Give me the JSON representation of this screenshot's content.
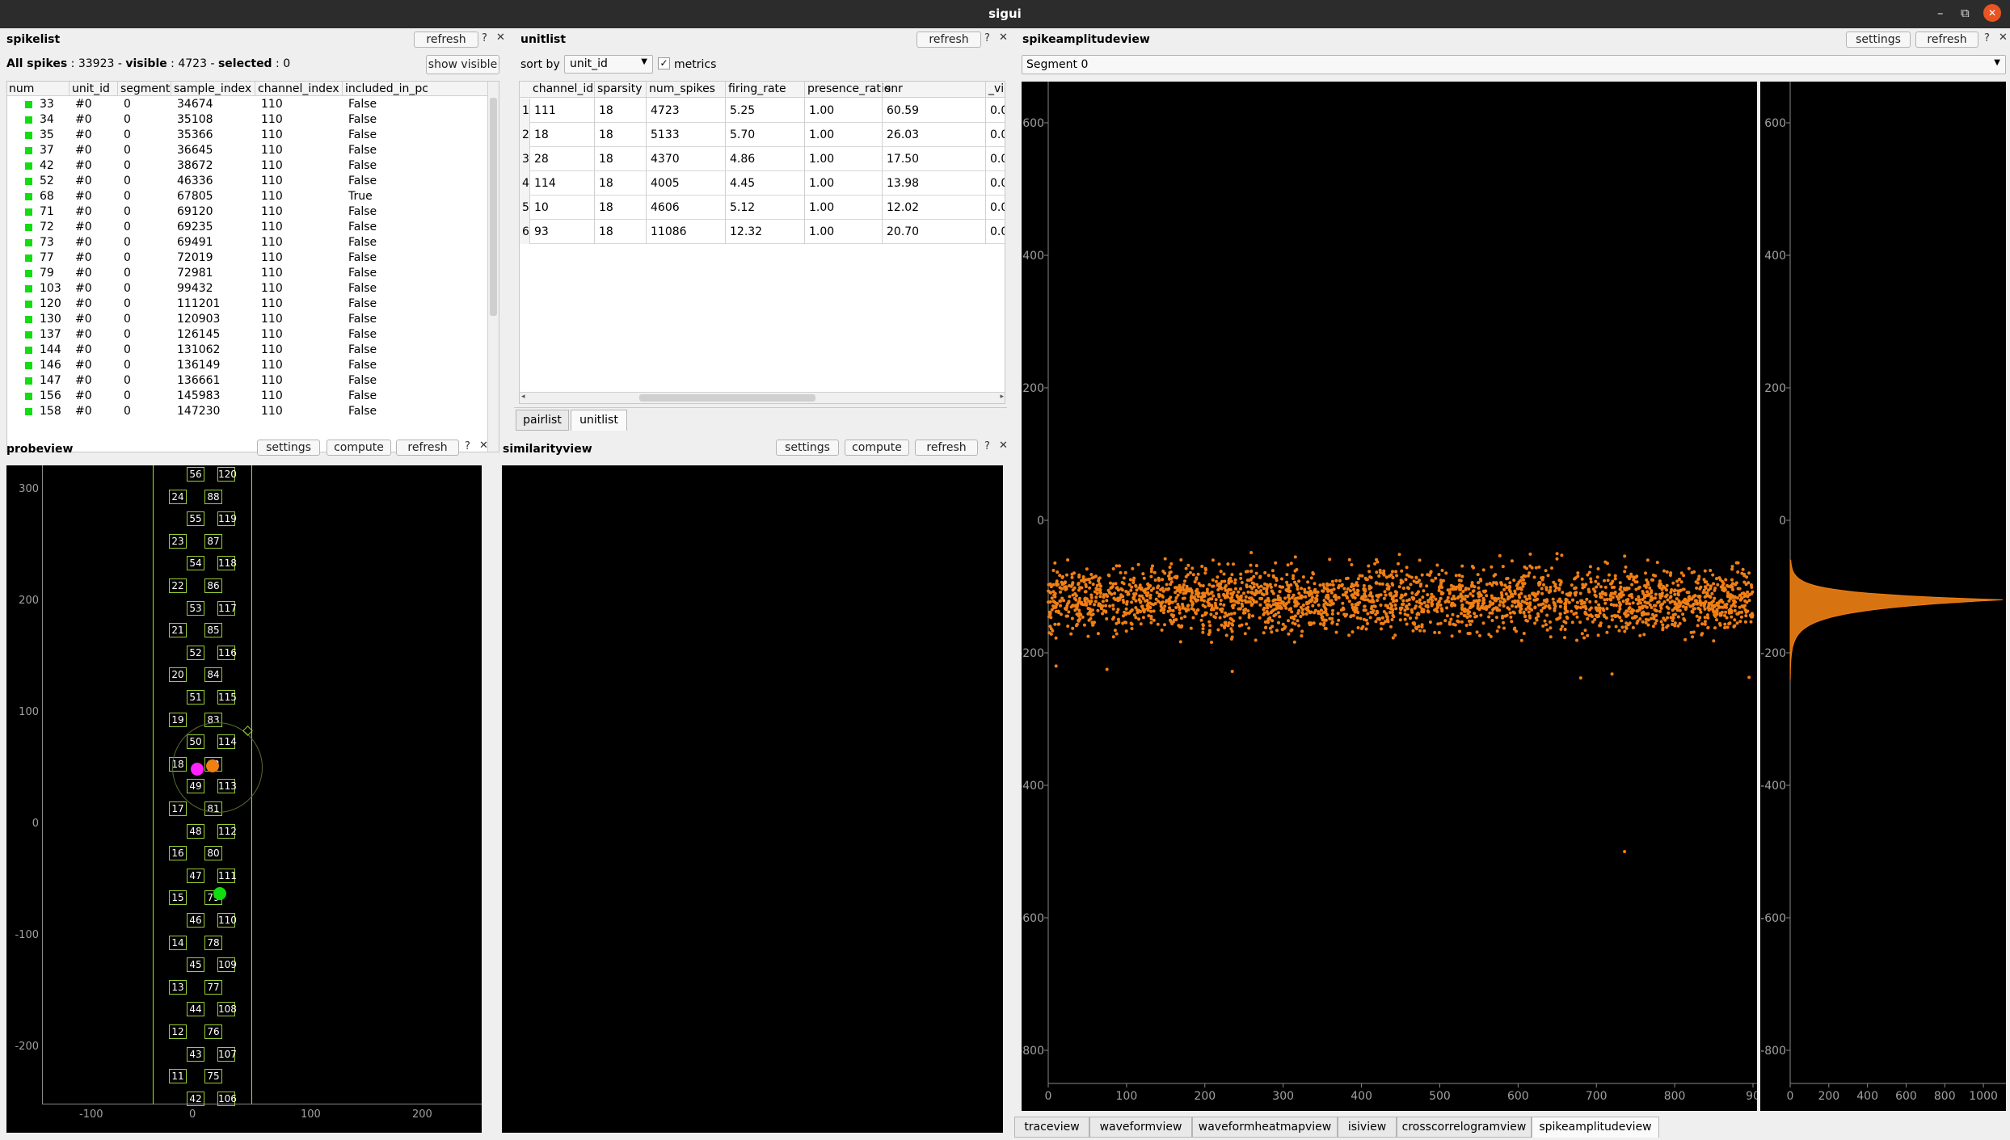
{
  "window": {
    "title": "sigui"
  },
  "colors": {
    "accent_orange": "#f07f14",
    "green": "#11dd11",
    "magenta": "#ff22ff",
    "probe_outline": "#9acd32"
  },
  "spikelist": {
    "title": "spikelist",
    "refresh_label": "refresh",
    "help_label": "?",
    "close_label": "✕",
    "summary_all_label": "All spikes",
    "summary_all": "33923",
    "summary_visible_label": "visible",
    "summary_visible": "4723",
    "summary_selected_label": "selected",
    "summary_selected": "0",
    "show_visible_label": "show visible",
    "columns": [
      "num",
      "unit_id",
      "segment",
      "sample_index",
      "channel_index",
      "included_in_pc"
    ],
    "rows": [
      [
        "33",
        "#0",
        "0",
        "34674",
        "110",
        "False"
      ],
      [
        "34",
        "#0",
        "0",
        "35108",
        "110",
        "False"
      ],
      [
        "35",
        "#0",
        "0",
        "35366",
        "110",
        "False"
      ],
      [
        "37",
        "#0",
        "0",
        "36645",
        "110",
        "False"
      ],
      [
        "42",
        "#0",
        "0",
        "38672",
        "110",
        "False"
      ],
      [
        "52",
        "#0",
        "0",
        "46336",
        "110",
        "False"
      ],
      [
        "68",
        "#0",
        "0",
        "67805",
        "110",
        "True"
      ],
      [
        "71",
        "#0",
        "0",
        "69120",
        "110",
        "False"
      ],
      [
        "72",
        "#0",
        "0",
        "69235",
        "110",
        "False"
      ],
      [
        "73",
        "#0",
        "0",
        "69491",
        "110",
        "False"
      ],
      [
        "77",
        "#0",
        "0",
        "72019",
        "110",
        "False"
      ],
      [
        "79",
        "#0",
        "0",
        "72981",
        "110",
        "False"
      ],
      [
        "103",
        "#0",
        "0",
        "99432",
        "110",
        "False"
      ],
      [
        "120",
        "#0",
        "0",
        "111201",
        "110",
        "False"
      ],
      [
        "130",
        "#0",
        "0",
        "120903",
        "110",
        "False"
      ],
      [
        "137",
        "#0",
        "0",
        "126145",
        "110",
        "False"
      ],
      [
        "144",
        "#0",
        "0",
        "131062",
        "110",
        "False"
      ],
      [
        "146",
        "#0",
        "0",
        "136149",
        "110",
        "False"
      ],
      [
        "147",
        "#0",
        "0",
        "136661",
        "110",
        "False"
      ],
      [
        "156",
        "#0",
        "0",
        "145983",
        "110",
        "False"
      ],
      [
        "158",
        "#0",
        "0",
        "147230",
        "110",
        "False"
      ]
    ]
  },
  "unitlist": {
    "title": "unitlist",
    "refresh_label": "refresh",
    "help_label": "?",
    "close_label": "✕",
    "sort_by_label": "sort by",
    "sort_value": "unit_id",
    "metrics_label": "metrics",
    "metrics_checked": "✓",
    "columns": [
      "channel_id",
      "sparsity",
      "num_spikes",
      "firing_rate",
      "presence_ratio",
      "snr",
      "_viola"
    ],
    "rows": [
      [
        "1",
        "111",
        "18",
        "4723",
        "5.25",
        "1.00",
        "60.59",
        "0.00"
      ],
      [
        "2",
        "18",
        "18",
        "5133",
        "5.70",
        "1.00",
        "26.03",
        "0.00"
      ],
      [
        "3",
        "28",
        "18",
        "4370",
        "4.86",
        "1.00",
        "17.50",
        "0.00"
      ],
      [
        "4",
        "114",
        "18",
        "4005",
        "4.45",
        "1.00",
        "13.98",
        "0.00"
      ],
      [
        "5",
        "10",
        "18",
        "4606",
        "5.12",
        "1.00",
        "12.02",
        "0.00"
      ],
      [
        "6",
        "93",
        "18",
        "11086",
        "12.32",
        "1.00",
        "20.70",
        "0.00"
      ]
    ],
    "tabs": [
      "pairlist",
      "unitlist"
    ]
  },
  "probeview": {
    "title": "probeview",
    "settings_label": "settings",
    "compute_label": "compute",
    "refresh_label": "refresh",
    "help_label": "?",
    "close_label": "✕",
    "y_ticks": [
      "300",
      "200",
      "100",
      "0",
      "-100",
      "-200"
    ],
    "x_ticks": [
      "-100",
      "0",
      "100",
      "200"
    ],
    "electrodes_left": [
      "56",
      "24",
      "55",
      "23",
      "54",
      "22",
      "53",
      "21",
      "52",
      "20",
      "51",
      "19",
      "50",
      "18",
      "49",
      "17",
      "48",
      "16",
      "47",
      "15",
      "46",
      "14",
      "45",
      "13",
      "44",
      "12",
      "43",
      "11",
      "42"
    ],
    "electrodes_right": [
      "120",
      "88",
      "119",
      "87",
      "118",
      "86",
      "117",
      "85",
      "116",
      "84",
      "115",
      "83",
      "114",
      "82",
      "113",
      "81",
      "112",
      "80",
      "111",
      "79",
      "110",
      "78",
      "109",
      "77",
      "108",
      "76",
      "107",
      "75",
      "106"
    ]
  },
  "similarityview": {
    "title": "similarityview",
    "settings_label": "settings",
    "compute_label": "compute",
    "refresh_label": "refresh",
    "help_label": "?",
    "close_label": "✕"
  },
  "spikeamplitudeview": {
    "title": "spikeamplitudeview",
    "settings_label": "settings",
    "refresh_label": "refresh",
    "help_label": "?",
    "close_label": "✕",
    "segment_label": "Segment 0",
    "y_ticks": [
      "600",
      "400",
      "200",
      "0",
      "-200",
      "-400",
      "-600",
      "-800"
    ],
    "x_ticks": [
      "0",
      "100",
      "200",
      "300",
      "400",
      "500",
      "600",
      "700",
      "800",
      "90"
    ],
    "hist_x_ticks": [
      "0",
      "200",
      "400",
      "600",
      "800",
      "1000"
    ]
  },
  "bottom_tabs": [
    "traceview",
    "waveformview",
    "waveformheatmapview",
    "isiview",
    "crosscorrelogramview",
    "spikeamplitudeview"
  ],
  "chart_data": {
    "type": "scatter",
    "title": "",
    "xlabel": "",
    "ylabel": "",
    "xlim": [
      0,
      900
    ],
    "ylim": [
      -850,
      650
    ],
    "series": [
      {
        "values_description_band": {
          "center": -120,
          "spread": 60,
          "count_visible": 4723
        }
      }
    ],
    "outliers": [
      {
        "x": 10,
        "y": -220
      },
      {
        "x": 75,
        "y": -225
      },
      {
        "x": 235,
        "y": -228
      },
      {
        "x": 680,
        "y": -238
      },
      {
        "x": 720,
        "y": -232
      },
      {
        "x": 736,
        "y": -500
      },
      {
        "x": 895,
        "y": -237
      }
    ],
    "histogram": {
      "type": "area",
      "xlim": [
        0,
        1100
      ],
      "peak_y": -120,
      "peak_count": 1100
    }
  }
}
